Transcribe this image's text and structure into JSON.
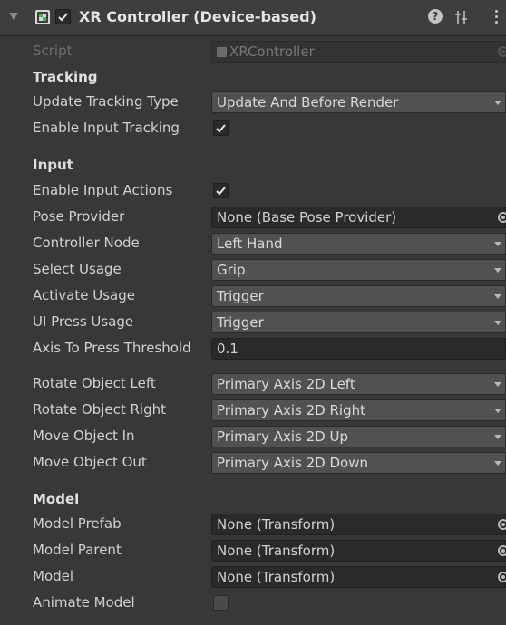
{
  "component": {
    "title": "XR Controller (Device-based)",
    "enabled": true,
    "help_icon": "question-mark-icon",
    "presets_icon": "presets-sliders-icon",
    "menu_icon": "vertical-ellipsis-icon"
  },
  "script": {
    "label": "Script",
    "value": "XRController"
  },
  "sections": {
    "tracking": "Tracking",
    "input": "Input",
    "model": "Model"
  },
  "fields": {
    "update_tracking_type": {
      "label": "Update Tracking Type",
      "value": "Update And Before Render"
    },
    "enable_input_tracking": {
      "label": "Enable Input Tracking",
      "checked": true
    },
    "enable_input_actions": {
      "label": "Enable Input Actions",
      "checked": true
    },
    "pose_provider": {
      "label": "Pose Provider",
      "value": "None (Base Pose Provider)"
    },
    "controller_node": {
      "label": "Controller Node",
      "value": "Left Hand"
    },
    "select_usage": {
      "label": "Select Usage",
      "value": "Grip"
    },
    "activate_usage": {
      "label": "Activate Usage",
      "value": "Trigger"
    },
    "ui_press_usage": {
      "label": "UI Press Usage",
      "value": "Trigger"
    },
    "axis_to_press_threshold": {
      "label": "Axis To Press Threshold",
      "value": "0.1"
    },
    "rotate_object_left": {
      "label": "Rotate Object Left",
      "value": "Primary Axis 2D Left"
    },
    "rotate_object_right": {
      "label": "Rotate Object Right",
      "value": "Primary Axis 2D Right"
    },
    "move_object_in": {
      "label": "Move Object In",
      "value": "Primary Axis 2D Up"
    },
    "move_object_out": {
      "label": "Move Object Out",
      "value": "Primary Axis 2D Down"
    },
    "model_prefab": {
      "label": "Model Prefab",
      "value": "None (Transform)"
    },
    "model_parent": {
      "label": "Model Parent",
      "value": "None (Transform)"
    },
    "model": {
      "label": "Model",
      "value": "None (Transform)"
    },
    "animate_model": {
      "label": "Animate Model",
      "checked": false
    }
  },
  "colors": {
    "background": "#383838",
    "header": "#3e3e3e",
    "field_dark": "#2a2a2a",
    "dropdown": "#515151",
    "text": "#d2d2d2",
    "icon_green": "#4fb04f"
  }
}
